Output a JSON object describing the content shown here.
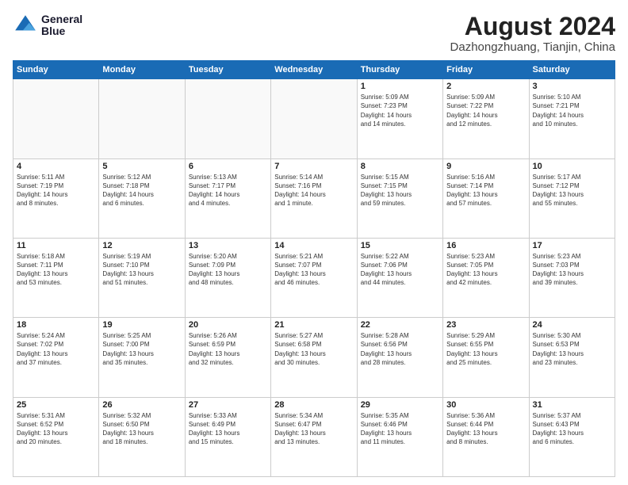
{
  "header": {
    "logo_line1": "General",
    "logo_line2": "Blue",
    "month": "August 2024",
    "location": "Dazhongzhuang, Tianjin, China"
  },
  "weekdays": [
    "Sunday",
    "Monday",
    "Tuesday",
    "Wednesday",
    "Thursday",
    "Friday",
    "Saturday"
  ],
  "weeks": [
    [
      {
        "day": "",
        "info": ""
      },
      {
        "day": "",
        "info": ""
      },
      {
        "day": "",
        "info": ""
      },
      {
        "day": "",
        "info": ""
      },
      {
        "day": "1",
        "info": "Sunrise: 5:09 AM\nSunset: 7:23 PM\nDaylight: 14 hours\nand 14 minutes."
      },
      {
        "day": "2",
        "info": "Sunrise: 5:09 AM\nSunset: 7:22 PM\nDaylight: 14 hours\nand 12 minutes."
      },
      {
        "day": "3",
        "info": "Sunrise: 5:10 AM\nSunset: 7:21 PM\nDaylight: 14 hours\nand 10 minutes."
      }
    ],
    [
      {
        "day": "4",
        "info": "Sunrise: 5:11 AM\nSunset: 7:19 PM\nDaylight: 14 hours\nand 8 minutes."
      },
      {
        "day": "5",
        "info": "Sunrise: 5:12 AM\nSunset: 7:18 PM\nDaylight: 14 hours\nand 6 minutes."
      },
      {
        "day": "6",
        "info": "Sunrise: 5:13 AM\nSunset: 7:17 PM\nDaylight: 14 hours\nand 4 minutes."
      },
      {
        "day": "7",
        "info": "Sunrise: 5:14 AM\nSunset: 7:16 PM\nDaylight: 14 hours\nand 1 minute."
      },
      {
        "day": "8",
        "info": "Sunrise: 5:15 AM\nSunset: 7:15 PM\nDaylight: 13 hours\nand 59 minutes."
      },
      {
        "day": "9",
        "info": "Sunrise: 5:16 AM\nSunset: 7:14 PM\nDaylight: 13 hours\nand 57 minutes."
      },
      {
        "day": "10",
        "info": "Sunrise: 5:17 AM\nSunset: 7:12 PM\nDaylight: 13 hours\nand 55 minutes."
      }
    ],
    [
      {
        "day": "11",
        "info": "Sunrise: 5:18 AM\nSunset: 7:11 PM\nDaylight: 13 hours\nand 53 minutes."
      },
      {
        "day": "12",
        "info": "Sunrise: 5:19 AM\nSunset: 7:10 PM\nDaylight: 13 hours\nand 51 minutes."
      },
      {
        "day": "13",
        "info": "Sunrise: 5:20 AM\nSunset: 7:09 PM\nDaylight: 13 hours\nand 48 minutes."
      },
      {
        "day": "14",
        "info": "Sunrise: 5:21 AM\nSunset: 7:07 PM\nDaylight: 13 hours\nand 46 minutes."
      },
      {
        "day": "15",
        "info": "Sunrise: 5:22 AM\nSunset: 7:06 PM\nDaylight: 13 hours\nand 44 minutes."
      },
      {
        "day": "16",
        "info": "Sunrise: 5:23 AM\nSunset: 7:05 PM\nDaylight: 13 hours\nand 42 minutes."
      },
      {
        "day": "17",
        "info": "Sunrise: 5:23 AM\nSunset: 7:03 PM\nDaylight: 13 hours\nand 39 minutes."
      }
    ],
    [
      {
        "day": "18",
        "info": "Sunrise: 5:24 AM\nSunset: 7:02 PM\nDaylight: 13 hours\nand 37 minutes."
      },
      {
        "day": "19",
        "info": "Sunrise: 5:25 AM\nSunset: 7:00 PM\nDaylight: 13 hours\nand 35 minutes."
      },
      {
        "day": "20",
        "info": "Sunrise: 5:26 AM\nSunset: 6:59 PM\nDaylight: 13 hours\nand 32 minutes."
      },
      {
        "day": "21",
        "info": "Sunrise: 5:27 AM\nSunset: 6:58 PM\nDaylight: 13 hours\nand 30 minutes."
      },
      {
        "day": "22",
        "info": "Sunrise: 5:28 AM\nSunset: 6:56 PM\nDaylight: 13 hours\nand 28 minutes."
      },
      {
        "day": "23",
        "info": "Sunrise: 5:29 AM\nSunset: 6:55 PM\nDaylight: 13 hours\nand 25 minutes."
      },
      {
        "day": "24",
        "info": "Sunrise: 5:30 AM\nSunset: 6:53 PM\nDaylight: 13 hours\nand 23 minutes."
      }
    ],
    [
      {
        "day": "25",
        "info": "Sunrise: 5:31 AM\nSunset: 6:52 PM\nDaylight: 13 hours\nand 20 minutes."
      },
      {
        "day": "26",
        "info": "Sunrise: 5:32 AM\nSunset: 6:50 PM\nDaylight: 13 hours\nand 18 minutes."
      },
      {
        "day": "27",
        "info": "Sunrise: 5:33 AM\nSunset: 6:49 PM\nDaylight: 13 hours\nand 15 minutes."
      },
      {
        "day": "28",
        "info": "Sunrise: 5:34 AM\nSunset: 6:47 PM\nDaylight: 13 hours\nand 13 minutes."
      },
      {
        "day": "29",
        "info": "Sunrise: 5:35 AM\nSunset: 6:46 PM\nDaylight: 13 hours\nand 11 minutes."
      },
      {
        "day": "30",
        "info": "Sunrise: 5:36 AM\nSunset: 6:44 PM\nDaylight: 13 hours\nand 8 minutes."
      },
      {
        "day": "31",
        "info": "Sunrise: 5:37 AM\nSunset: 6:43 PM\nDaylight: 13 hours\nand 6 minutes."
      }
    ]
  ]
}
